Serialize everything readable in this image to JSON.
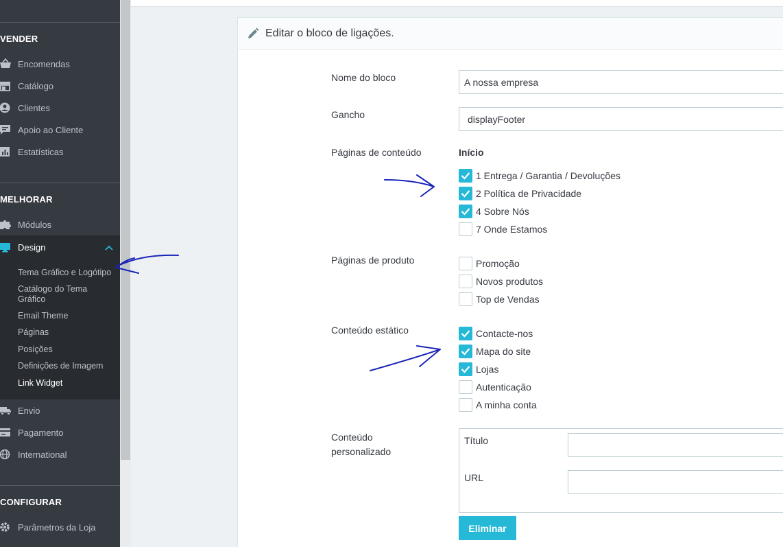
{
  "sidebar": {
    "sections": [
      {
        "title": "VENDER"
      },
      {
        "title": "MELHORAR"
      },
      {
        "title": "CONFIGURAR"
      }
    ],
    "sell_items": [
      {
        "label": "Encomendas",
        "icon": "basket-icon"
      },
      {
        "label": "Catálogo",
        "icon": "store-icon"
      },
      {
        "label": "Clientes",
        "icon": "user-circle-icon"
      },
      {
        "label": "Apoio ao Cliente",
        "icon": "chat-icon"
      },
      {
        "label": "Estatísticas",
        "icon": "bar-chart-icon"
      }
    ],
    "improve_items": [
      {
        "label": "Módulos",
        "icon": "puzzle-icon"
      }
    ],
    "design": {
      "label": "Design",
      "icon": "monitor-icon",
      "accent": "#25b9d7",
      "subitems": [
        "Tema Gráfico e Logótipo",
        "Catálogo do Tema Gráfico",
        "Email Theme",
        "Páginas",
        "Posições",
        "Definições de Imagem",
        "Link Widget"
      ]
    },
    "more_items": [
      {
        "label": "Envio",
        "icon": "truck-icon"
      },
      {
        "label": "Pagamento",
        "icon": "credit-card-icon"
      },
      {
        "label": "International",
        "icon": "globe-icon"
      }
    ],
    "configure_items": [
      {
        "label": "Parâmetros da Loja",
        "icon": "gear-icon"
      }
    ]
  },
  "panel": {
    "title": "Editar o bloco de ligações.",
    "title_icon": "pencil-icon"
  },
  "form": {
    "block_name": {
      "label": "Nome do bloco",
      "value": "A nossa empresa"
    },
    "hook": {
      "label": "Gancho",
      "value": "displayFooter"
    },
    "content_pages": {
      "label": "Páginas de conteúdo",
      "group": "Início",
      "items": [
        {
          "label": "1 Entrega / Garantia / Devoluções",
          "checked": true
        },
        {
          "label": "2 Política de Privacidade",
          "checked": true
        },
        {
          "label": "4 Sobre Nós",
          "checked": true
        },
        {
          "label": "7 Onde Estamos",
          "checked": false
        }
      ]
    },
    "product_pages": {
      "label": "Páginas de produto",
      "items": [
        {
          "label": "Promoção",
          "checked": false
        },
        {
          "label": "Novos produtos",
          "checked": false
        },
        {
          "label": "Top de Vendas",
          "checked": false
        }
      ]
    },
    "static_content": {
      "label": "Conteúdo estático",
      "items": [
        {
          "label": "Contacte-nos",
          "checked": true
        },
        {
          "label": "Mapa do site",
          "checked": true
        },
        {
          "label": "Lojas",
          "checked": true
        },
        {
          "label": "Autenticação",
          "checked": false
        },
        {
          "label": "A minha conta",
          "checked": false
        }
      ]
    },
    "custom_content": {
      "label_line1": "Conteúdo",
      "label_line2": "personalizado",
      "title_label": "Título",
      "url_label": "URL",
      "title_value": "",
      "url_value": ""
    },
    "delete_button": "Eliminar"
  },
  "colors": {
    "sidebar_bg": "#363a41",
    "primary": "#25b9d7",
    "annotation_ink": "#1a23b8"
  }
}
